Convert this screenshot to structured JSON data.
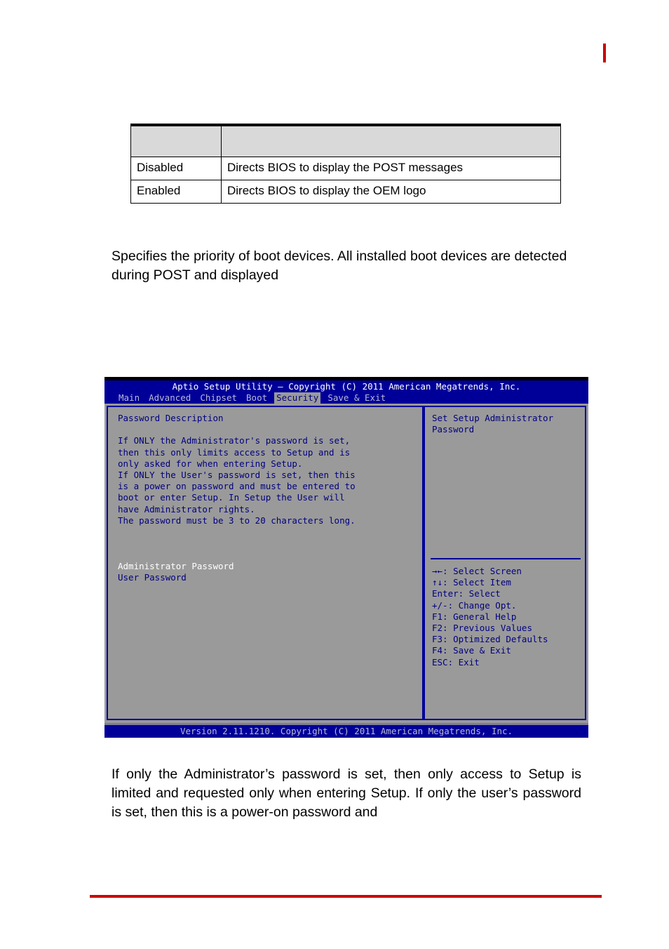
{
  "page": {
    "accent_red": "#cc0000",
    "header_tick": "",
    "footer_rule": ""
  },
  "option_table": {
    "columns": [
      "",
      ""
    ],
    "header": [
      "",
      ""
    ],
    "rows": [
      [
        "Disabled",
        "Directs BIOS to display the POST messages"
      ],
      [
        "Enabled",
        "Directs BIOS to display the OEM logo"
      ]
    ]
  },
  "paragraphs": {
    "boot_priority": "Specifies the priority of boot devices. All installed boot devices are detected during POST and displayed",
    "password_note": "If only the Administrator’s password is set, then only access to Setup is limited and requested only when entering Setup. If only the user’s password is set, then this is a power-on password and"
  },
  "bios": {
    "title": "Aptio Setup Utility – Copyright (C) 2011 American Megatrends, Inc.",
    "menu": [
      {
        "label": "Main",
        "active": false
      },
      {
        "label": "Advanced",
        "active": false
      },
      {
        "label": "Chipset",
        "active": false
      },
      {
        "label": "Boot",
        "active": false
      },
      {
        "label": "Security",
        "active": true
      },
      {
        "label": "Save & Exit",
        "active": false
      }
    ],
    "left_panel": {
      "heading": "Password Description",
      "description_lines": [
        "If ONLY the Administrator's password is set,",
        "then this only limits access to Setup and is",
        "only asked for when entering Setup.",
        "If ONLY the User's password is set, then this",
        "is a power on password and must be entered to",
        "boot or enter Setup. In Setup the User will",
        "have Administrator rights.",
        "The password must be 3 to 20 characters long."
      ],
      "fields": [
        {
          "label": "Administrator Password",
          "selected": true
        },
        {
          "label": "User Password",
          "selected": false
        }
      ]
    },
    "right_panel": {
      "help_lines": [
        "Set Setup Administrator",
        "Password"
      ],
      "keys": [
        "→←: Select Screen",
        "↑↓: Select Item",
        "Enter: Select",
        "+/-: Change Opt.",
        "F1: General Help",
        "F2: Previous Values",
        "F3: Optimized Defaults",
        "F4: Save & Exit",
        "ESC: Exit"
      ]
    },
    "footer": "Version 2.11.1210. Copyright (C) 2011 American Megatrends, Inc.",
    "colors": {
      "chrome_blue": "#000099",
      "panel_gray": "#9a9a9a",
      "text_blue": "#000080",
      "text_light": "#b9b9d6",
      "text_white": "#ffffff"
    }
  }
}
